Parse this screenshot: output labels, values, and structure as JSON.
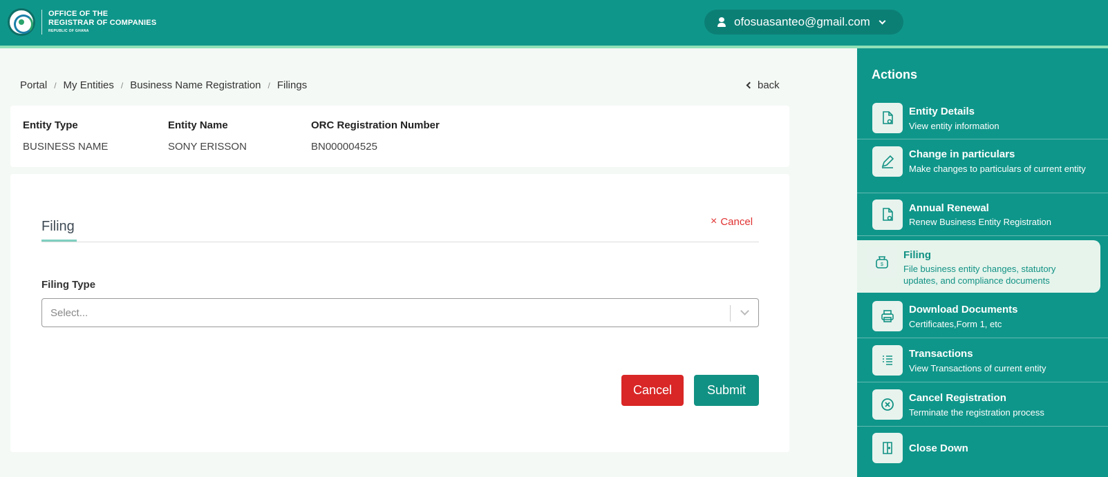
{
  "header": {
    "logo_line1": "OFFICE OF THE",
    "logo_line2": "REGISTRAR OF COMPANIES",
    "logo_line3": "REPUBLIC OF GHANA",
    "user_email": "ofosuasanteo@gmail.com"
  },
  "breadcrumb": [
    "Portal",
    "My Entities",
    "Business Name Registration",
    "Filings"
  ],
  "back_label": "back",
  "entity": {
    "type_label": "Entity Type",
    "type_value": "BUSINESS NAME",
    "name_label": "Entity Name",
    "name_value": "SONY ERISSON",
    "reg_label": "ORC Registration Number",
    "reg_value": "BN000004525"
  },
  "form": {
    "tab_label": "Filing",
    "tab_cancel": "Cancel",
    "field_label": "Filing Type",
    "select_placeholder": "Select...",
    "cancel_button": "Cancel",
    "submit_button": "Submit"
  },
  "sidebar": {
    "title": "Actions",
    "items": [
      {
        "title": "Entity Details",
        "desc": "View entity information",
        "icon": "document-eye-icon"
      },
      {
        "title": "Change in particulars",
        "desc": "Make changes to particulars of current entity",
        "icon": "pencil-icon"
      },
      {
        "title": "Annual Renewal",
        "desc": "Renew Business Entity Registration",
        "icon": "document-eye-icon"
      },
      {
        "title": "Filing",
        "desc": "File business entity changes, statutory updates, and compliance documents",
        "icon": "money-bag-icon"
      },
      {
        "title": "Download Documents",
        "desc": "Certificates,Form 1, etc",
        "icon": "printer-icon"
      },
      {
        "title": "Transactions",
        "desc": "View Transactions of current entity",
        "icon": "list-icon"
      },
      {
        "title": "Cancel Registration",
        "desc": "Terminate the registration process",
        "icon": "circle-x-icon"
      },
      {
        "title": "Close Down",
        "desc": "",
        "icon": "door-icon"
      }
    ]
  },
  "colors": {
    "primary": "#0f968a",
    "accent_stripe": "#8fe0b8",
    "danger": "#d92626",
    "page_bg": "#f4f9f5"
  }
}
